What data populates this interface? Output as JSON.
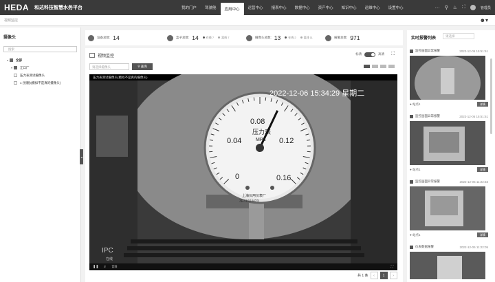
{
  "header": {
    "logo": "HEDA",
    "platform": "和达科技智慧水务平台",
    "nav": [
      {
        "label": "我的门户"
      },
      {
        "label": "驾驶舱"
      },
      {
        "label": "应用中心",
        "active": true
      },
      {
        "label": "运营中心"
      },
      {
        "label": "报表中心"
      },
      {
        "label": "数据中心"
      },
      {
        "label": "资产中心"
      },
      {
        "label": "知识中心"
      },
      {
        "label": "运维中心"
      },
      {
        "label": "设置中心"
      }
    ],
    "more": "···",
    "user": "管理员"
  },
  "breadcrumb": "视频监控",
  "left": {
    "title": "摄像头",
    "search_placeholder": "搜索",
    "tree": [
      {
        "label": "全部",
        "level": 0,
        "checked": true,
        "bold": true
      },
      {
        "label": "江口厂",
        "level": 1,
        "checked": true
      },
      {
        "label": "压力表测试摄像头",
        "level": 2,
        "checked": false
      },
      {
        "label": "1 (别删)(模拟不是真的摄像头)",
        "level": 2,
        "checked": false
      }
    ]
  },
  "stats": [
    {
      "label": "设备总数:",
      "value": "14"
    },
    {
      "label": "盒子总数:",
      "value": "14",
      "online_label": "在线",
      "online": "7",
      "offline_label": "离线",
      "offline": "7"
    },
    {
      "label": "摄像头总数:",
      "value": "13",
      "online_label": "在线",
      "online": "2",
      "offline_label": "离线",
      "offline": "11"
    },
    {
      "label": "报警总数:",
      "value": "971"
    }
  ],
  "main": {
    "title": "视频监控",
    "toggle_left": "标清",
    "toggle_right": "高清",
    "select_placeholder": "请选择摄像头",
    "search_button": "查询",
    "camera_name": "压力表测试摄像头(模拟不是真的摄像头)",
    "overlay_datetime": "2022-12-06 15:34:29 星期二",
    "gauge": {
      "title": "压力表",
      "unit": "MPa",
      "ticks": [
        "0",
        "0.04",
        "0.08",
        "0.12",
        "0.16"
      ],
      "serial": "3E31004423",
      "maker": "上海仪用仪表厂",
      "value": 0.095
    },
    "osd": "IPC",
    "online": "在线",
    "audio_label": "音频",
    "pagination": {
      "total": "共 1 条",
      "page": "1",
      "prev": "‹",
      "next": "›"
    }
  },
  "right": {
    "title": "实时报警列表",
    "select_placeholder": "请选择",
    "alarms": [
      {
        "name": "监控画面异常报警",
        "time": "2022-12-05 15:51:51",
        "point": "站点1",
        "detail": "详情"
      },
      {
        "name": "监控画面异常报警",
        "time": "2022-12-05 15:51:51",
        "point": "站点1",
        "detail": "详情"
      },
      {
        "name": "监控画面异常报警",
        "time": "2022-12-05 11:22:33",
        "point": "站点1",
        "detail": "详情"
      },
      {
        "name": "仪表数据报警",
        "time": "2022-12-05 11:22:05",
        "point": "站点1",
        "detail": "详情"
      }
    ]
  }
}
